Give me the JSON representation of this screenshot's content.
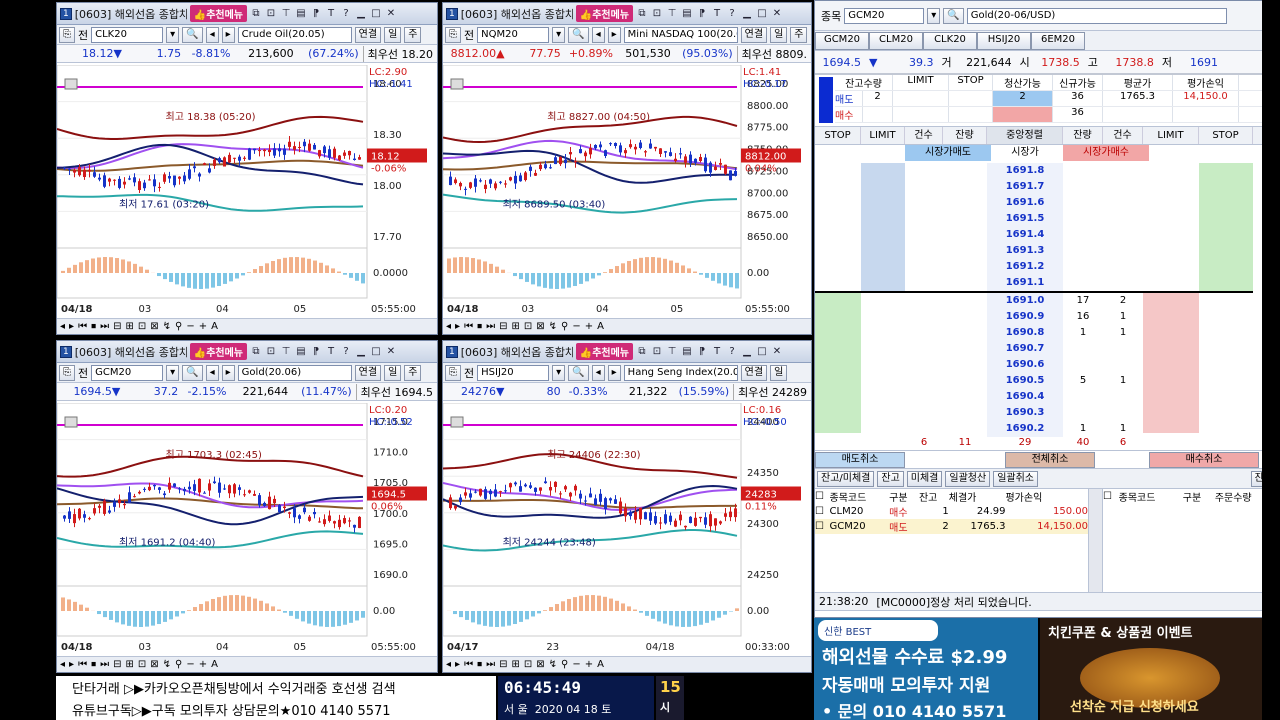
{
  "windows": [
    {
      "id": "w1",
      "num": "1",
      "title": "[0603] 해외선옵 종합차트",
      "menu": "추천메뉴",
      "mode": "전",
      "code": "CLK20",
      "name": "Crude Oil(20.05)",
      "link": "연결",
      "period": "일",
      "right": "주",
      "price": "18.12▼",
      "change": "1.75",
      "pct": "-8.81%",
      "volume": "213,600",
      "vpct": "(67.24%)",
      "best": "최우선 18.20",
      "lc": "LC:2.90",
      "hc": "HC:-1.41",
      "last": "18.12",
      "lastpct": "-0.06%",
      "yticks": [
        "18.60",
        "18.30",
        "18.00",
        "17.70"
      ],
      "osc": "0.0000",
      "hi_label": "최고 18.38 (05:20)",
      "lo_label": "최저 17.61 (03:20)",
      "xticks": [
        "04/18",
        "03",
        "04",
        "05"
      ],
      "time": "05:55:00"
    },
    {
      "id": "w2",
      "num": "1",
      "title": "[0603] 해외선옵 종합차트",
      "menu": "추천메뉴",
      "mode": "전",
      "code": "NQM20",
      "name": "Mini NASDAQ 100(20.06)",
      "link": "연결",
      "period": "일",
      "right": "주",
      "price": "8812.00▲",
      "change": "77.75",
      "pct": "+0.89%",
      "volume": "501,530",
      "vpct": "(95.03%)",
      "best": "최우선 8809.",
      "lc": "LC:1.41",
      "hc": "HC:-0.17",
      "last": "8812.00",
      "lastpct": "0.04%",
      "yticks": [
        "8825.00",
        "8800.00",
        "8775.00",
        "8750.00",
        "8725.00",
        "8700.00",
        "8675.00",
        "8650.00"
      ],
      "osc": "0.00",
      "hi_label": "최고 8827.00 (04:50)",
      "lo_label": "최저 8689.50 (03:40)",
      "xticks": [
        "04/18",
        "03",
        "04",
        "05"
      ],
      "time": "05:55:00"
    },
    {
      "id": "w3",
      "num": "1",
      "title": "[0603] 해외선옵 종합차트",
      "menu": "추천메뉴",
      "mode": "전",
      "code": "GCM20",
      "name": "Gold(20.06)",
      "link": "연결",
      "period": "일",
      "right": "주",
      "price": "1694.5▼",
      "change": "37.2",
      "pct": "-2.15%",
      "volume": "221,644",
      "vpct": "(11.47%)",
      "best": "최우선 1694.5",
      "lc": "LC:0.20",
      "hc": "HC:-0.52",
      "last": "1694.5",
      "lastpct": "0.06%",
      "yticks": [
        "1715.0",
        "1710.0",
        "1705.0",
        "1700.0",
        "1695.0",
        "1690.0"
      ],
      "osc": "0.00",
      "hi_label": "최고 1703.3 (02:45)",
      "lo_label": "최저 1691.2 (04:40)",
      "xticks": [
        "04/18",
        "03",
        "04",
        "05"
      ],
      "time": "05:55:00"
    },
    {
      "id": "w4",
      "num": "1",
      "title": "[0603] 해외선옵 종합차트",
      "menu": "추천메뉴",
      "mode": "전",
      "code": "HSIJ20",
      "name": "Hang Seng Index(20.04)",
      "link": "연결",
      "period": "일",
      "right": "",
      "price": "24276▼",
      "change": "80",
      "pct": "-0.33%",
      "volume": "21,322",
      "vpct": "(15.59%)",
      "best": "최우선 24289",
      "lc": "LC:0.16",
      "hc": "HC:-0.50",
      "last": "24283",
      "lastpct": "0.11%",
      "yticks": [
        "24400",
        "24350",
        "24300",
        "24250"
      ],
      "osc": "0.00",
      "hi_label": "최고 24406 (22:30)",
      "lo_label": "최저 24244 (23:48)",
      "xticks": [
        "04/17",
        "23",
        "04/18"
      ],
      "time": "00:33:00"
    }
  ],
  "order": {
    "label": "종목",
    "code": "GCM20",
    "name": "Gold(20-06/USD)",
    "tabs": [
      "GCM20",
      "CLM20",
      "CLK20",
      "HSIJ20",
      "6EM20"
    ],
    "price": "1694.5",
    "arrow": "▼",
    "change": "39.3",
    "volume_label": "거",
    "volume": "221,644",
    "open_label": "시",
    "open": "1738.5",
    "high_label": "고",
    "high": "1738.8",
    "low_label": "저",
    "low": "1691",
    "pos_headers": [
      "잔고수량",
      "LIMIT",
      "STOP",
      "청산가능",
      "신규가능",
      "평균가",
      "평가손익"
    ],
    "sell_label": "매도",
    "buy_label": "매수",
    "pos_sell": [
      "2",
      "",
      "",
      "2",
      "36",
      "1765.3",
      "14,150.0"
    ],
    "pos_buy": [
      "",
      "",
      "",
      "",
      "36",
      "",
      ""
    ],
    "book_headers": [
      "STOP",
      "LIMIT",
      "건수",
      "잔량",
      "중앙정렬",
      "잔량",
      "건수",
      "LIMIT",
      "STOP"
    ],
    "mkt_sell": "시장가매도",
    "mkt_label": "시장가",
    "mkt_buy": "시장가매수",
    "asks": [
      "1691.8",
      "1691.7",
      "1691.6",
      "1691.5",
      "1691.4",
      "1691.3",
      "1691.2",
      "1691.1"
    ],
    "bids": [
      {
        "p": "1691.0",
        "q": "17",
        "c": "2"
      },
      {
        "p": "1690.9",
        "q": "16",
        "c": "1"
      },
      {
        "p": "1690.8",
        "q": "1",
        "c": "1"
      },
      {
        "p": "1690.7",
        "q": "",
        "c": ""
      },
      {
        "p": "1690.6",
        "q": "",
        "c": ""
      },
      {
        "p": "1690.5",
        "q": "5",
        "c": "1"
      },
      {
        "p": "1690.4",
        "q": "",
        "c": ""
      },
      {
        "p": "1690.3",
        "q": "",
        "c": ""
      },
      {
        "p": "1690.2",
        "q": "1",
        "c": "1"
      }
    ],
    "totals": [
      "6",
      "11",
      "29",
      "40",
      "6"
    ],
    "cancel_sell": "매도취소",
    "cancel_all": "전체취소",
    "cancel_buy": "매수취소",
    "tabs2": [
      "잔고/미체결",
      "잔고",
      "미체결",
      "일괄청산",
      "일괄취소"
    ],
    "tab_right": "잔고",
    "bal_headers": [
      "종목코드",
      "구분",
      "잔고",
      "체결가",
      "평가손익"
    ],
    "balances": [
      {
        "code": "CLM20",
        "side": "매수",
        "qty": "1",
        "price": "24.99",
        "pnl": "150.00"
      },
      {
        "code": "GCM20",
        "side": "매도",
        "qty": "2",
        "price": "1765.3",
        "pnl": "14,150.00"
      }
    ],
    "right_headers": [
      "종목코드",
      "구분",
      "주문수량"
    ],
    "status_time": "21:38:20",
    "status_msg": "[MC0000]정상 처리 되었습니다."
  },
  "ad1": {
    "brand": "신한 BEST",
    "line1": "해외선물 수수료 $2.99",
    "line2": "자동매매 모의투자 지원",
    "line3": "• 문의 010 4140 5571"
  },
  "ad2": {
    "title": "치킨쿠폰 & 상품권 이벤트",
    "sub": "선착순 지급 신청하세요"
  },
  "ticker": {
    "line1": "단타거래 ▷▶카카오오픈채팅방에서 수익거래중 호선생 검색",
    "line2": "유튜브구독▷▶구독 모의투자 상담문의★010 4140 5571"
  },
  "clock": {
    "time": "06:45:49",
    "date_label": "서 울",
    "date": "2020 04 18 토",
    "side_a": "15",
    "side_b": "시"
  },
  "colors": {
    "up": "#d11b1b",
    "down": "#1634c8",
    "magenta": "#d000d0",
    "darkred": "#8b1010",
    "navy": "#14206e",
    "violet": "#a050f0",
    "teal": "#2aa8a8",
    "brown": "#8b5a2b"
  }
}
